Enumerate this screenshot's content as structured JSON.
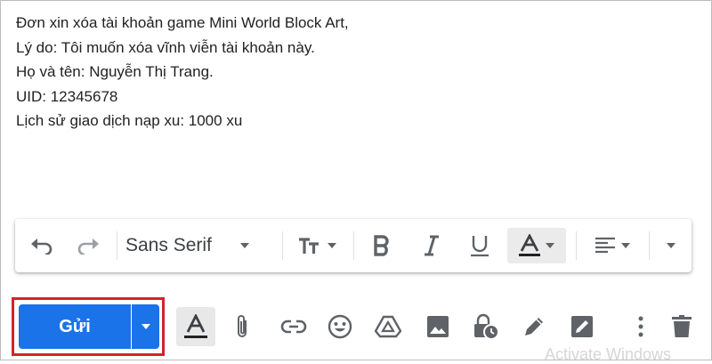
{
  "body_lines": [
    "Đơn xin xóa tài khoản game Mini World Block Art,",
    "Lý do: Tôi muốn xóa vĩnh viễn tài khoản này.",
    "Họ và tên: Nguyễn Thị Trang.",
    "UID: 12345678",
    "Lịch sử giao dịch nạp xu: 1000 xu"
  ],
  "formatting": {
    "font_family": "Sans Serif"
  },
  "compose": {
    "send_label": "Gửi"
  },
  "watermark": "Activate Windows",
  "colors": {
    "send_button": "#1a73e8",
    "highlight_border": "#d2232a",
    "icon": "#5f6368"
  }
}
